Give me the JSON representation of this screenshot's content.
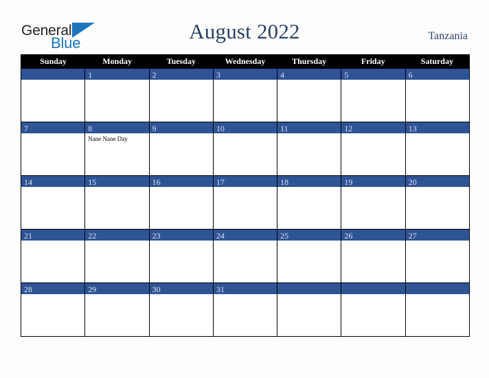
{
  "brand": {
    "name_part1": "General",
    "name_part2": "Blue",
    "triangle_color": "#1b75bc",
    "text_color": "#231f20"
  },
  "header": {
    "title": "August 2022",
    "country": "Tanzania",
    "title_color": "#2a3f63"
  },
  "colors": {
    "band": "#2f5496",
    "weekday_header_bg": "#000000",
    "weekday_header_text": "#ffffff",
    "day_number": "#dbe2ef",
    "cell_bg": "#ffffff",
    "page_bg": "#fdfdfd",
    "grid_line": "#000000"
  },
  "calendar": {
    "weekdays": [
      "Sunday",
      "Monday",
      "Tuesday",
      "Wednesday",
      "Thursday",
      "Friday",
      "Saturday"
    ],
    "weeks": [
      [
        {
          "day": "",
          "events": []
        },
        {
          "day": "1",
          "events": []
        },
        {
          "day": "2",
          "events": []
        },
        {
          "day": "3",
          "events": []
        },
        {
          "day": "4",
          "events": []
        },
        {
          "day": "5",
          "events": []
        },
        {
          "day": "6",
          "events": []
        }
      ],
      [
        {
          "day": "7",
          "events": []
        },
        {
          "day": "8",
          "events": [
            "Nane Nane Day"
          ]
        },
        {
          "day": "9",
          "events": []
        },
        {
          "day": "10",
          "events": []
        },
        {
          "day": "11",
          "events": []
        },
        {
          "day": "12",
          "events": []
        },
        {
          "day": "13",
          "events": []
        }
      ],
      [
        {
          "day": "14",
          "events": []
        },
        {
          "day": "15",
          "events": []
        },
        {
          "day": "16",
          "events": []
        },
        {
          "day": "17",
          "events": []
        },
        {
          "day": "18",
          "events": []
        },
        {
          "day": "19",
          "events": []
        },
        {
          "day": "20",
          "events": []
        }
      ],
      [
        {
          "day": "21",
          "events": []
        },
        {
          "day": "22",
          "events": []
        },
        {
          "day": "23",
          "events": []
        },
        {
          "day": "24",
          "events": []
        },
        {
          "day": "25",
          "events": []
        },
        {
          "day": "26",
          "events": []
        },
        {
          "day": "27",
          "events": []
        }
      ],
      [
        {
          "day": "28",
          "events": []
        },
        {
          "day": "29",
          "events": []
        },
        {
          "day": "30",
          "events": []
        },
        {
          "day": "31",
          "events": []
        },
        {
          "day": "",
          "events": []
        },
        {
          "day": "",
          "events": []
        },
        {
          "day": "",
          "events": []
        }
      ]
    ]
  }
}
